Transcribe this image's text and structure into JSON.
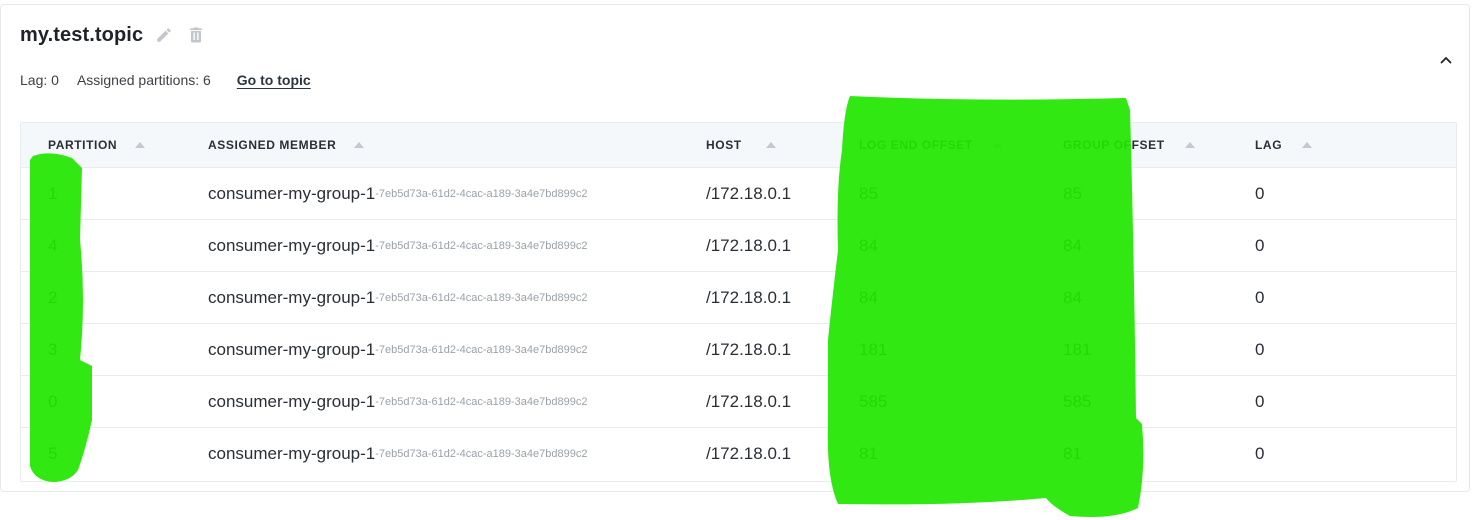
{
  "topic": {
    "title": "my.test.topic",
    "lag_text": "Lag: 0",
    "assigned_partitions_text": "Assigned partitions: 6",
    "go_to_topic_label": "Go to topic"
  },
  "icons": {
    "edit": "pencil-icon",
    "delete": "trash-icon",
    "collapse": "chevron-up-icon"
  },
  "table": {
    "columns": [
      "PARTITION",
      "ASSIGNED MEMBER",
      "HOST",
      "LOG END OFFSET",
      "GROUP OFFSET",
      "LAG"
    ],
    "rows": [
      {
        "partition": "1",
        "member": "consumer-my-group-1",
        "member_id": "-7eb5d73a-61d2-4cac-a189-3a4e7bd899c2",
        "host": "/172.18.0.1",
        "log_end_offset": "85",
        "group_offset": "85",
        "lag": "0"
      },
      {
        "partition": "4",
        "member": "consumer-my-group-1",
        "member_id": "-7eb5d73a-61d2-4cac-a189-3a4e7bd899c2",
        "host": "/172.18.0.1",
        "log_end_offset": "84",
        "group_offset": "84",
        "lag": "0"
      },
      {
        "partition": "2",
        "member": "consumer-my-group-1",
        "member_id": "-7eb5d73a-61d2-4cac-a189-3a4e7bd899c2",
        "host": "/172.18.0.1",
        "log_end_offset": "84",
        "group_offset": "84",
        "lag": "0"
      },
      {
        "partition": "3",
        "member": "consumer-my-group-1",
        "member_id": "-7eb5d73a-61d2-4cac-a189-3a4e7bd899c2",
        "host": "/172.18.0.1",
        "log_end_offset": "181",
        "group_offset": "181",
        "lag": "0"
      },
      {
        "partition": "0",
        "member": "consumer-my-group-1",
        "member_id": "-7eb5d73a-61d2-4cac-a189-3a4e7bd899c2",
        "host": "/172.18.0.1",
        "log_end_offset": "585",
        "group_offset": "585",
        "lag": "0"
      },
      {
        "partition": "5",
        "member": "consumer-my-group-1",
        "member_id": "-7eb5d73a-61d2-4cac-a189-3a4e7bd899c2",
        "host": "/172.18.0.1",
        "log_end_offset": "81",
        "group_offset": "81",
        "lag": "0"
      }
    ]
  },
  "colors": {
    "highlight": "#22e600",
    "header_bg": "#f5f8fb",
    "border": "#e8ebef"
  }
}
